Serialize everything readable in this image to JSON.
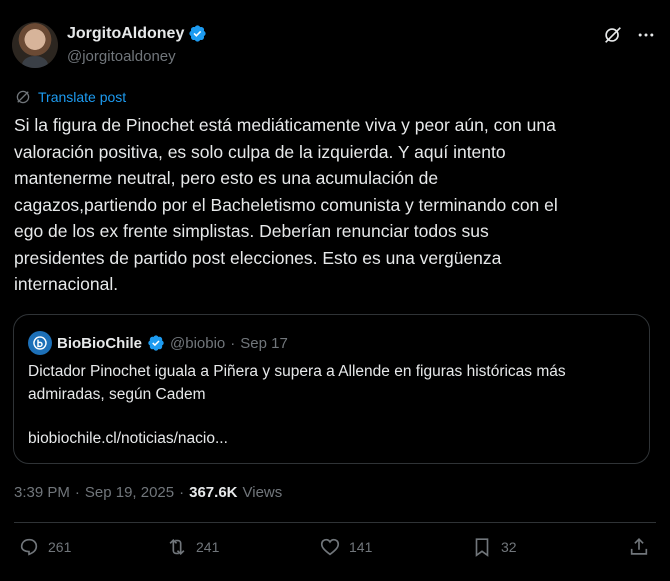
{
  "author": {
    "display_name": "JorgitoAldoney",
    "handle": "@jorgitoaldoney"
  },
  "translate_label": "Translate post",
  "post_text": "Si la figura de Pinochet está mediáticamente viva y peor aún, con una\nvaloración positiva, es solo culpa de la izquierda. Y aquí intento\nmantenerme neutral, pero esto es una acumulación de\ncagazos,partiendo por el Bacheletismo comunista y terminando con el\nego de los ex frente simplistas. Deberían renunciar todos sus\npresidentes de partido post elecciones. Esto es una vergüenza\ninternacional.",
  "quote": {
    "display_name": "BioBioChile",
    "handle": "@biobio",
    "separator": "·",
    "date": "Sep 17",
    "text": "Dictador Pinochet iguala a Piñera y supera a Allende en figuras históricas más admiradas, según Cadem",
    "link": "biobiochile.cl/noticias/nacio..."
  },
  "meta": {
    "time": "3:39 PM",
    "separator": "·",
    "date": "Sep 19, 2025",
    "separator2": "·",
    "views_count": "367.6K",
    "views_label": "Views"
  },
  "actions": {
    "replies": "261",
    "reposts": "241",
    "likes": "141",
    "bookmarks": "32"
  },
  "colors": {
    "accent": "#1d9bf0",
    "muted": "#71767b",
    "border": "#2f3336",
    "background": "#000000"
  }
}
